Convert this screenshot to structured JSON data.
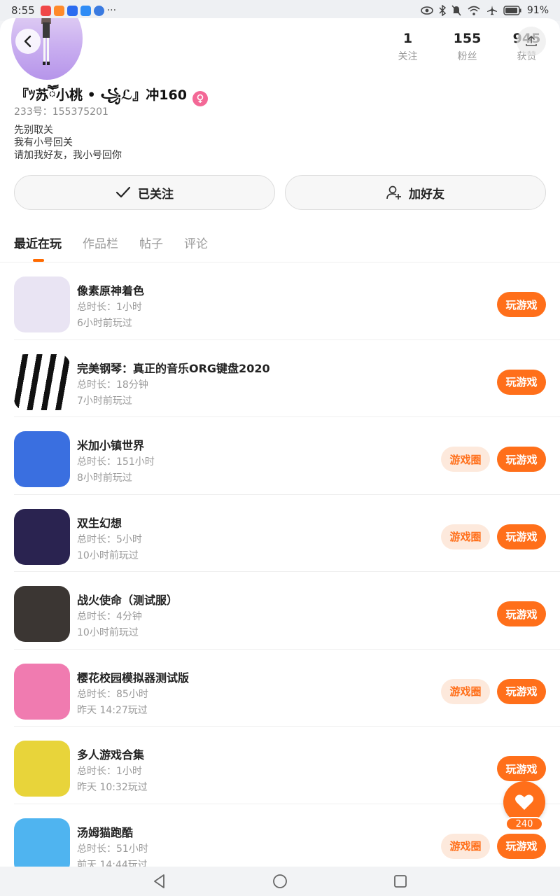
{
  "status_bar": {
    "time": "8:55",
    "status_icons": [
      "eye-icon",
      "bluetooth-icon",
      "mute-icon",
      "wifi-icon",
      "airplane-icon",
      "battery-icon"
    ],
    "battery": "91%"
  },
  "profile": {
    "name": "『ﾂ苏ཽ小桃 • ꧁ℒ』冲160",
    "gender": "female",
    "uid_label": "233号：",
    "uid": "155375201",
    "bio": [
      "先别取关",
      "我有小号回关",
      "请加我好友，我小号回你"
    ],
    "stats": [
      {
        "num": "1",
        "label": "关注"
      },
      {
        "num": "155",
        "label": "粉丝"
      },
      {
        "num": "945",
        "label": "获赞"
      }
    ]
  },
  "actions": {
    "followed_label": "已关注",
    "add_friend_label": "加好友"
  },
  "tabs": [
    "最近在玩",
    "作品栏",
    "帖子",
    "评论"
  ],
  "games": [
    {
      "title": "像素原神着色",
      "duration": "总时长：1小时",
      "last_played": "6小时前玩过",
      "has_circle": false,
      "thumb_color": "#e9e4f3"
    },
    {
      "title": "完美钢琴：真正的音乐ORG键盘2020",
      "duration": "总时长：18分钟",
      "last_played": "7小时前玩过",
      "has_circle": false,
      "thumb_color": "#ffffff"
    },
    {
      "title": "米加小镇世界",
      "duration": "总时长：151小时",
      "last_played": "8小时前玩过",
      "has_circle": true,
      "thumb_color": "#3a6fe0"
    },
    {
      "title": "双生幻想",
      "duration": "总时长：5小时",
      "last_played": "10小时前玩过",
      "has_circle": true,
      "thumb_color": "#2a2350"
    },
    {
      "title": "战火使命（测试服）",
      "duration": "总时长：4分钟",
      "last_played": "10小时前玩过",
      "has_circle": false,
      "thumb_color": "#3b3633"
    },
    {
      "title": "樱花校园模拟器测试版",
      "duration": "总时长：85小时",
      "last_played": "昨天 14:27玩过",
      "has_circle": true,
      "thumb_color": "#f07bb0"
    },
    {
      "title": "多人游戏合集",
      "duration": "总时长：1小时",
      "last_played": "昨天 10:32玩过",
      "has_circle": false,
      "thumb_color": "#e8d43a"
    },
    {
      "title": "汤姆猫跑酷",
      "duration": "总时长：51小时",
      "last_played": "前天 14:44玩过",
      "has_circle": true,
      "thumb_color": "#4fb4f0"
    }
  ],
  "play_label": "玩游戏",
  "circle_label": "游戏圈",
  "like_count": "240",
  "colors": {
    "accent": "#ff6f1a",
    "accent_soft": "#fde9dc",
    "gender_female": "#f36896"
  }
}
